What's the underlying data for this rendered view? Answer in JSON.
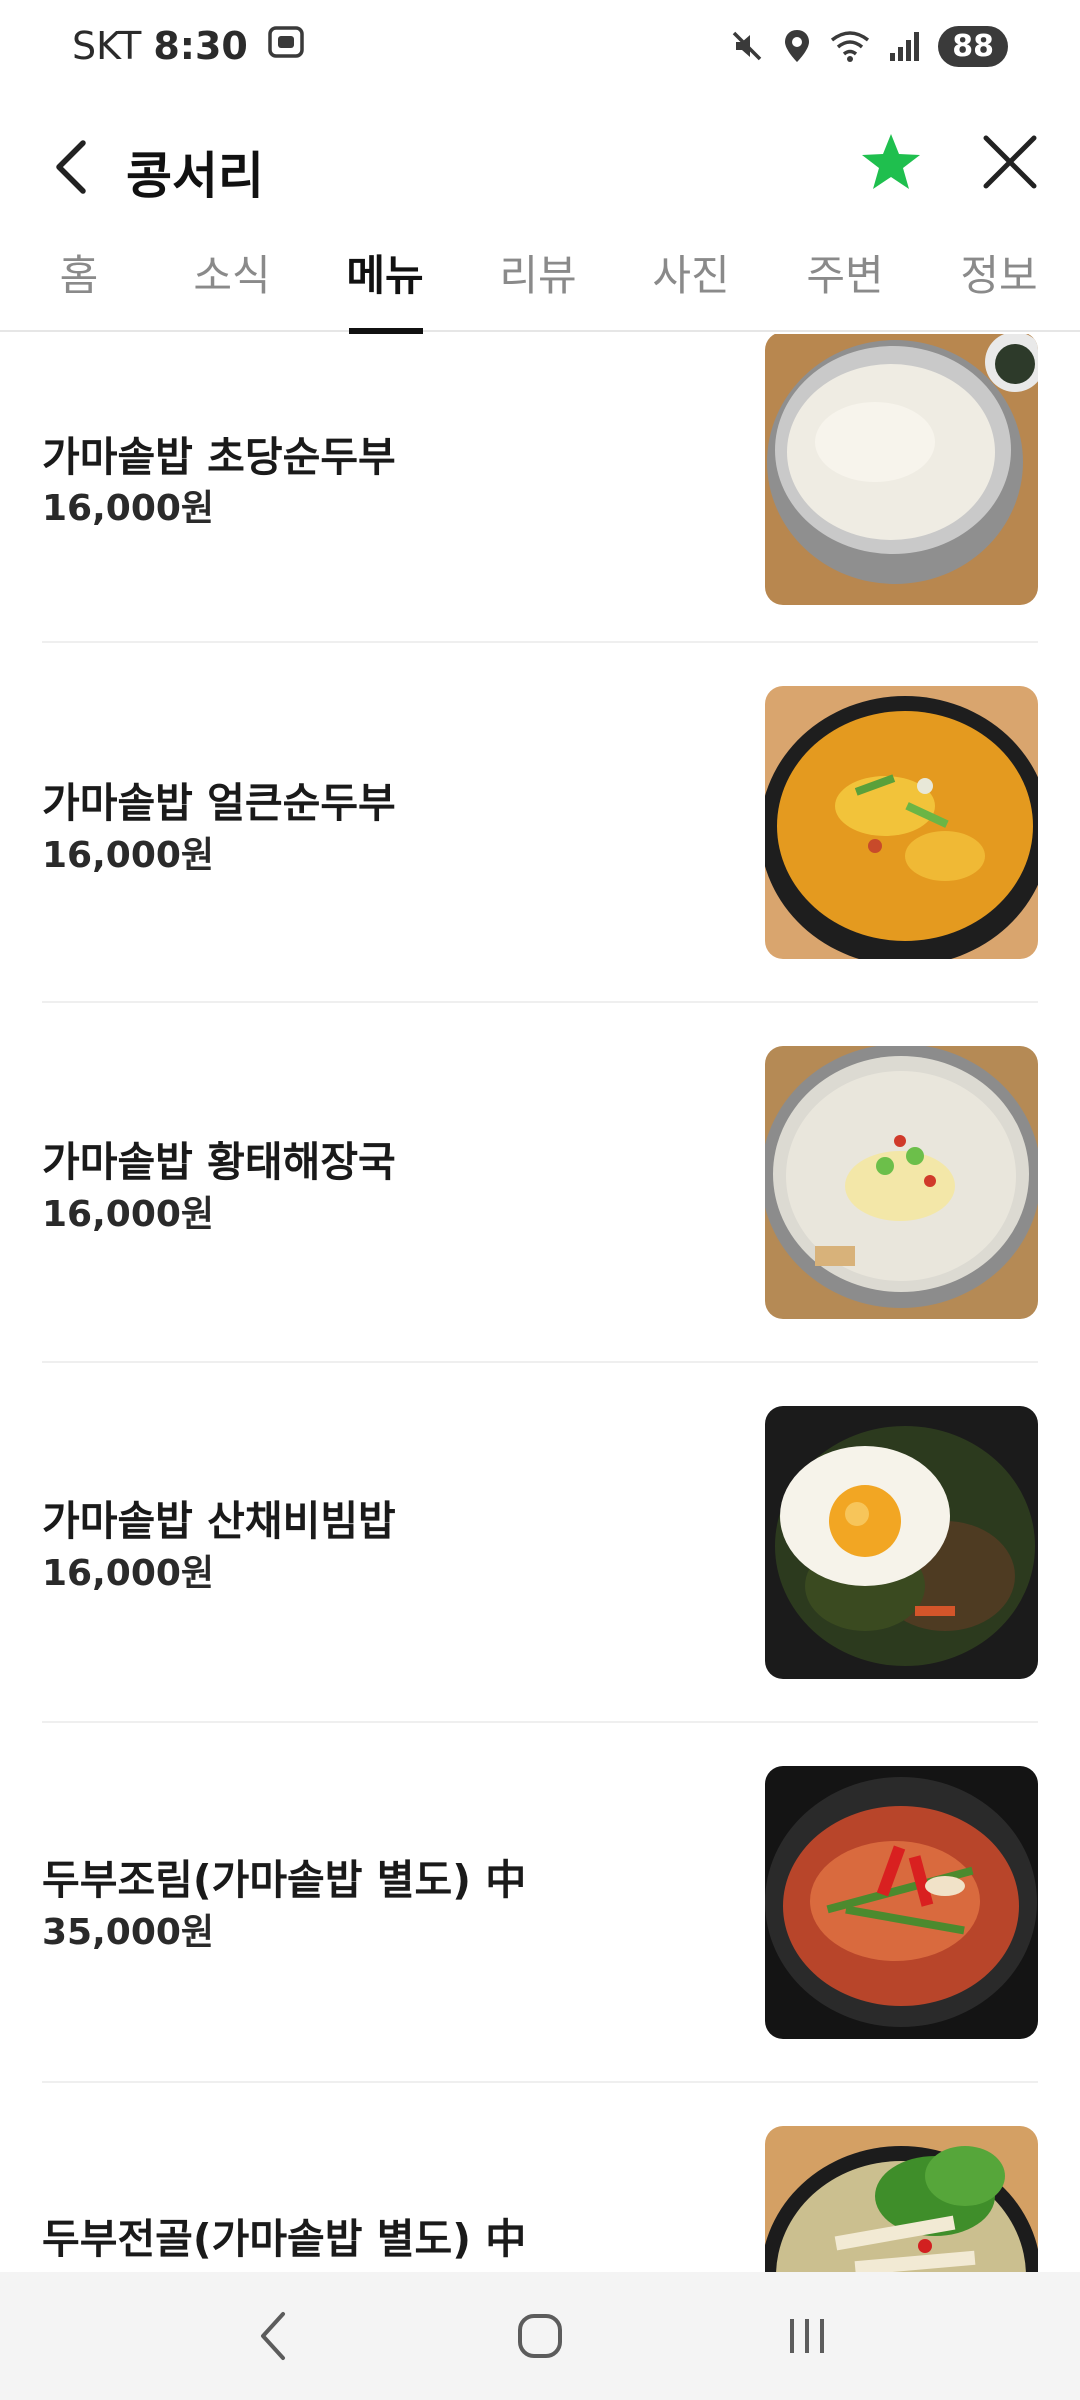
{
  "status_bar": {
    "carrier": "SKT",
    "time": "8:30",
    "battery": "88"
  },
  "header": {
    "title": "콩서리"
  },
  "tabs": [
    {
      "label": "홈",
      "active": false
    },
    {
      "label": "소식",
      "active": false
    },
    {
      "label": "메뉴",
      "active": true
    },
    {
      "label": "리뷰",
      "active": false
    },
    {
      "label": "사진",
      "active": false
    },
    {
      "label": "주변",
      "active": false
    },
    {
      "label": "정보",
      "active": false
    }
  ],
  "menu": [
    {
      "name": "가마솥밥 초당순두부",
      "price": "16,000원"
    },
    {
      "name": "가마솥밥 얼큰순두부",
      "price": "16,000원"
    },
    {
      "name": "가마솥밥 황태해장국",
      "price": "16,000원"
    },
    {
      "name": "가마솥밥 산채비빔밥",
      "price": "16,000원"
    },
    {
      "name": "두부조림(가마솥밥 별도) 中",
      "price": "35,000원"
    },
    {
      "name": "두부전골(가마솥밥 별도) 中",
      "price": ""
    }
  ],
  "colors": {
    "favorite_star": "#1fbf4e",
    "active_tab": "#111111",
    "inactive_tab": "#8a8a8a"
  },
  "icons": {
    "back": "chevron-left-icon",
    "favorite": "star-icon",
    "close": "close-icon",
    "nav_back": "nav-back-icon",
    "nav_home": "nav-home-icon",
    "nav_recents": "nav-recents-icon"
  }
}
